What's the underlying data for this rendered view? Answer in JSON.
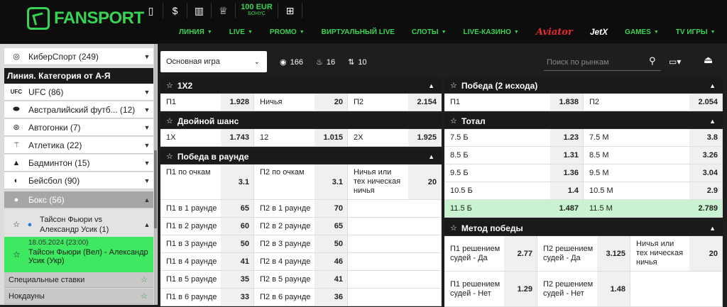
{
  "header": {
    "logo_text": "FANSPORT",
    "bonus_amount": "100 EUR",
    "bonus_label": "БОНУС",
    "nav": [
      "ЛИНИЯ",
      "LIVE",
      "PROMO",
      "ВИРТУАЛЬНЫЙ LIVE",
      "СЛОТЫ",
      "LIVE-КАЗИНО",
      "Aviator",
      "JetX",
      "GAMES",
      "TV ИГРЫ"
    ]
  },
  "sidebar": {
    "cybersport": "КиберСпорт (249)",
    "section_title": "Линия. Категория от А-Я",
    "items": [
      {
        "label": "UFC (86)",
        "icon": "ufc-icon"
      },
      {
        "label": "Австралийский футб... (12)",
        "icon": "aussie-football-icon"
      },
      {
        "label": "Автогонки (7)",
        "icon": "steering-wheel-icon"
      },
      {
        "label": "Атлетика (22)",
        "icon": "runner-icon"
      },
      {
        "label": "Бадминтон (15)",
        "icon": "shuttlecock-icon"
      },
      {
        "label": "Бейсбол (90)",
        "icon": "baseball-icon"
      },
      {
        "label": "Бокс (56)",
        "icon": "boxing-glove-icon"
      }
    ],
    "league": "Тайсон Фьюри vs Александр Усик (1)",
    "event_date": "18.05.2024 (23:00)",
    "event_name": "Тайсон Фьюри (Вел) - Александр Усик (Укр)",
    "special": "Специальные ставки",
    "knockdowns": "Нокдауны"
  },
  "toolbar": {
    "game_select": "Основная игра",
    "count_all": "166",
    "count_hot": "16",
    "count_moves": "10",
    "search_placeholder": "Поиск по рынкам"
  },
  "markets": {
    "m1x2": {
      "title": "1X2",
      "p1": "П1",
      "p1v": "1.928",
      "x": "Ничья",
      "xv": "20",
      "p2": "П2",
      "p2v": "2.154"
    },
    "double": {
      "title": "Двойной шанс",
      "a": "1X",
      "av": "1.743",
      "b": "12",
      "bv": "1.015",
      "c": "2X",
      "cv": "1.925"
    },
    "round": {
      "title": "Победа в раунде",
      "top": [
        {
          "n": "П1 по очкам",
          "v": "3.1"
        },
        {
          "n": "П2 по очкам",
          "v": "3.1"
        },
        {
          "n": "Ничья или тех ническая ничья",
          "v": "20"
        }
      ],
      "rows": [
        {
          "a": "П1 в 1 раунде",
          "av": "65",
          "b": "П2 в 1 раунде",
          "bv": "70"
        },
        {
          "a": "П1 в 2 раунде",
          "av": "60",
          "b": "П2 в 2 раунде",
          "bv": "65"
        },
        {
          "a": "П1 в 3 раунде",
          "av": "50",
          "b": "П2 в 3 раунде",
          "bv": "50"
        },
        {
          "a": "П1 в 4 раунде",
          "av": "41",
          "b": "П2 в 4 раунде",
          "bv": "46"
        },
        {
          "a": "П1 в 5 раунде",
          "av": "35",
          "b": "П2 в 5 раунде",
          "bv": "41"
        },
        {
          "a": "П1 в 6 раунде",
          "av": "33",
          "b": "П2 в 6 раунде",
          "bv": "36"
        }
      ]
    },
    "win2": {
      "title": "Победа (2 исхода)",
      "p1": "П1",
      "p1v": "1.838",
      "p2": "П2",
      "p2v": "2.054"
    },
    "total": {
      "title": "Тотал",
      "rows": [
        {
          "a": "7.5 Б",
          "av": "1.23",
          "b": "7.5 М",
          "bv": "3.8"
        },
        {
          "a": "8.5 Б",
          "av": "1.31",
          "b": "8.5 М",
          "bv": "3.26"
        },
        {
          "a": "9.5 Б",
          "av": "1.36",
          "b": "9.5 М",
          "bv": "3.04"
        },
        {
          "a": "10.5 Б",
          "av": "1.4",
          "b": "10.5 М",
          "bv": "2.9"
        },
        {
          "a": "11.5 Б",
          "av": "1.487",
          "b": "11.5 М",
          "bv": "2.789"
        }
      ]
    },
    "method": {
      "title": "Метод победы",
      "rows": [
        [
          {
            "n": "П1 решением судей - Да",
            "v": "2.77"
          },
          {
            "n": "П2 решением судей - Да",
            "v": "3.125"
          },
          {
            "n": "Ничья или тех ническая ничья",
            "v": "20"
          }
        ],
        [
          {
            "n": "П1 решением судей - Нет",
            "v": "1.29"
          },
          {
            "n": "П2 решением судей - Нет",
            "v": "1.48"
          }
        ]
      ]
    }
  },
  "colors": {
    "accent": "#39d353",
    "highlight": "#c9f3d0",
    "aviator": "#e32b2b"
  }
}
